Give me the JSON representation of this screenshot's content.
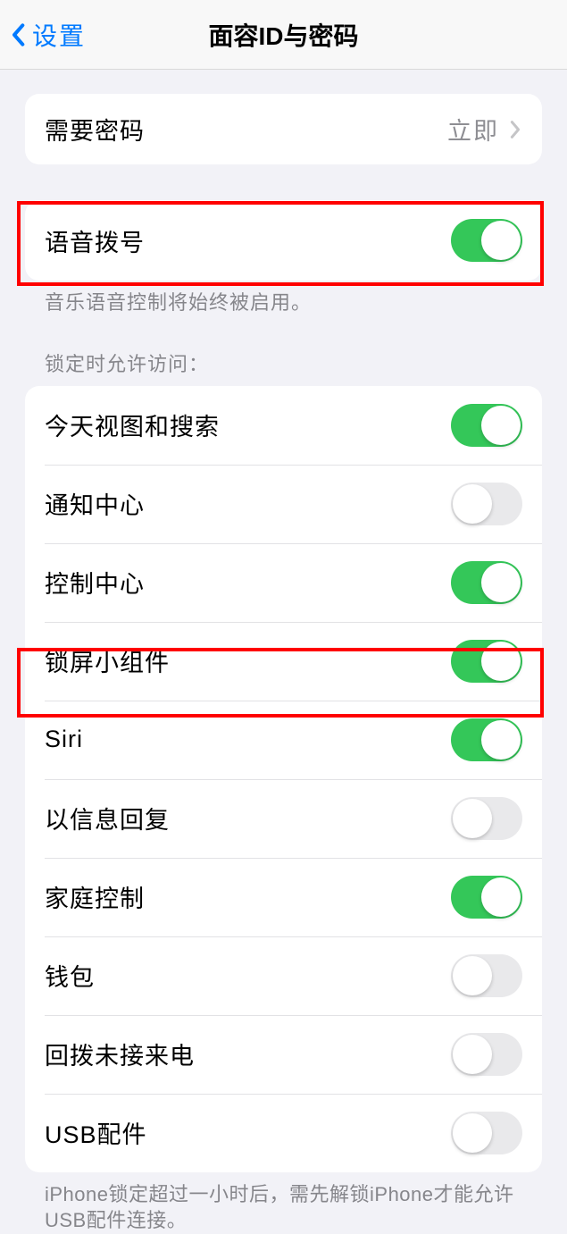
{
  "nav": {
    "back_label": "设置",
    "title": "面容ID与密码"
  },
  "passcode": {
    "label": "需要密码",
    "value": "立即"
  },
  "voice_dial": {
    "label": "语音拨号",
    "on": true,
    "footer": "音乐语音控制将始终被启用。"
  },
  "locked_access": {
    "header": "锁定时允许访问：",
    "items": [
      {
        "label": "今天视图和搜索",
        "on": true
      },
      {
        "label": "通知中心",
        "on": false
      },
      {
        "label": "控制中心",
        "on": true
      },
      {
        "label": "锁屏小组件",
        "on": true
      },
      {
        "label": "Siri",
        "on": true
      },
      {
        "label": "以信息回复",
        "on": false
      },
      {
        "label": "家庭控制",
        "on": true
      },
      {
        "label": "钱包",
        "on": false
      },
      {
        "label": "回拨未接来电",
        "on": false
      },
      {
        "label": "USB配件",
        "on": false
      }
    ],
    "footer": "iPhone锁定超过一小时后，需先解锁iPhone才能允许USB配件连接。"
  }
}
